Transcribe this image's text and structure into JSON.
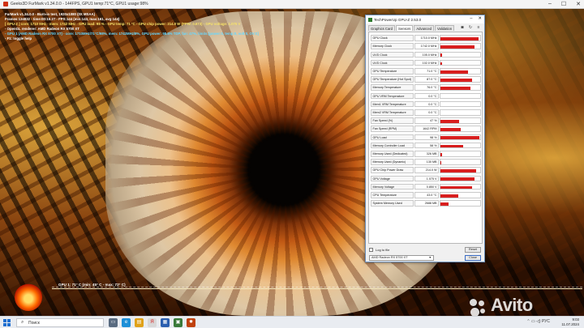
{
  "furmark": {
    "window_title": "Geeks3D FurMark v1.34.0.0 - 144FPS, GPU1 temp:71°C, GPU1 usage:98%",
    "osd": {
      "line1": "FurMark v1.34.0.0 - Burn-in test, 1920x1080 (0X MSAA)",
      "line2": "Frames:134832 - time:00:15:27 - FPS:144 (min:143, max:161, avg:144)",
      "line3": "[ GPU-Z ] core: 1710 MHz - mem: 1742 MHz - GPU load: 98 % - GPU temp: 71 °C - GPU chip power: 214.0 W (PPW: 0.673) - GPU voltage: 1.075 V",
      "line4": "- OpenGL renderer: AMD Radeon RX 5700 XT",
      "line5": "- GPU 1 (AMD Radeon RX 5700 XT) - core: 1710MHz/71°C/98%, mem: 1742MHz/8%, GPU power: 98.6% TDP, fan: 47%, limits:[power:0, temp:0, volt:0, OV:0]",
      "line6": "- F1: toggle help"
    },
    "graph_label": "GPU 1: 71° C (min: 45° C - max: 72° C)"
  },
  "gpuz": {
    "title": "TechPowerUp GPU-Z 2.53.0",
    "tabs": [
      "Graphics Card",
      "Sensors",
      "Advanced",
      "Validation"
    ],
    "active_tab": "Sensors",
    "sensors": [
      {
        "name": "GPU Clock",
        "value": "1710.0 MHz",
        "fill": 0.95
      },
      {
        "name": "Memory Clock",
        "value": "1742.0 MHz",
        "fill": 0.85
      },
      {
        "name": "UVD Clock",
        "value": "105.0 MHz",
        "fill": 0.05
      },
      {
        "name": "UVD Clock",
        "value": "102.0 MHz",
        "fill": 0.05
      },
      {
        "name": "GPU Temperature",
        "value": "71.0 °C",
        "fill": 0.7
      },
      {
        "name": "GPU Temperature (Hot Spot)",
        "value": "87.0 °C",
        "fill": 0.8
      },
      {
        "name": "Memory Temperature",
        "value": "76.0 °C",
        "fill": 0.75
      },
      {
        "name": "GPU VRM Temperature",
        "value": "0.0 °C",
        "fill": 0
      },
      {
        "name": "Mem1 VRM Temperature",
        "value": "0.0 °C",
        "fill": 0
      },
      {
        "name": "Mem2 VRM Temperature",
        "value": "0.0 °C",
        "fill": 0
      },
      {
        "name": "Fan Speed (%)",
        "value": "47 %",
        "fill": 0.47
      },
      {
        "name": "Fan Speed (RPM)",
        "value": "1642 RPM",
        "fill": 0.5
      },
      {
        "name": "GPU Load",
        "value": "98 %",
        "fill": 0.98
      },
      {
        "name": "Memory Controller Load",
        "value": "58 %",
        "fill": 0.58
      },
      {
        "name": "Memory Used (Dedicated)",
        "value": "326 MB",
        "fill": 0.04
      },
      {
        "name": "Memory Used (Dynamic)",
        "value": "130 MB",
        "fill": 0.02
      },
      {
        "name": "GPU Chip Power Draw",
        "value": "214.0 W",
        "fill": 0.9
      },
      {
        "name": "GPU Voltage",
        "value": "1.075 V",
        "fill": 0.85
      },
      {
        "name": "Memory Voltage",
        "value": "0.850 V",
        "fill": 0.8
      },
      {
        "name": "CPU Temperature",
        "value": "43.0 °C",
        "fill": 0.45
      },
      {
        "name": "System Memory Used",
        "value": "2688 MB",
        "fill": 0.2
      }
    ],
    "log_label": "Log to file",
    "reset_label": "Reset",
    "gpu_select": "AMD Radeon RX 5700 XT",
    "close_label": "Close"
  },
  "taskbar": {
    "search_placeholder": "Поиск",
    "time": "9:03",
    "date": "11.07.2024"
  },
  "watermark": "Avito"
}
